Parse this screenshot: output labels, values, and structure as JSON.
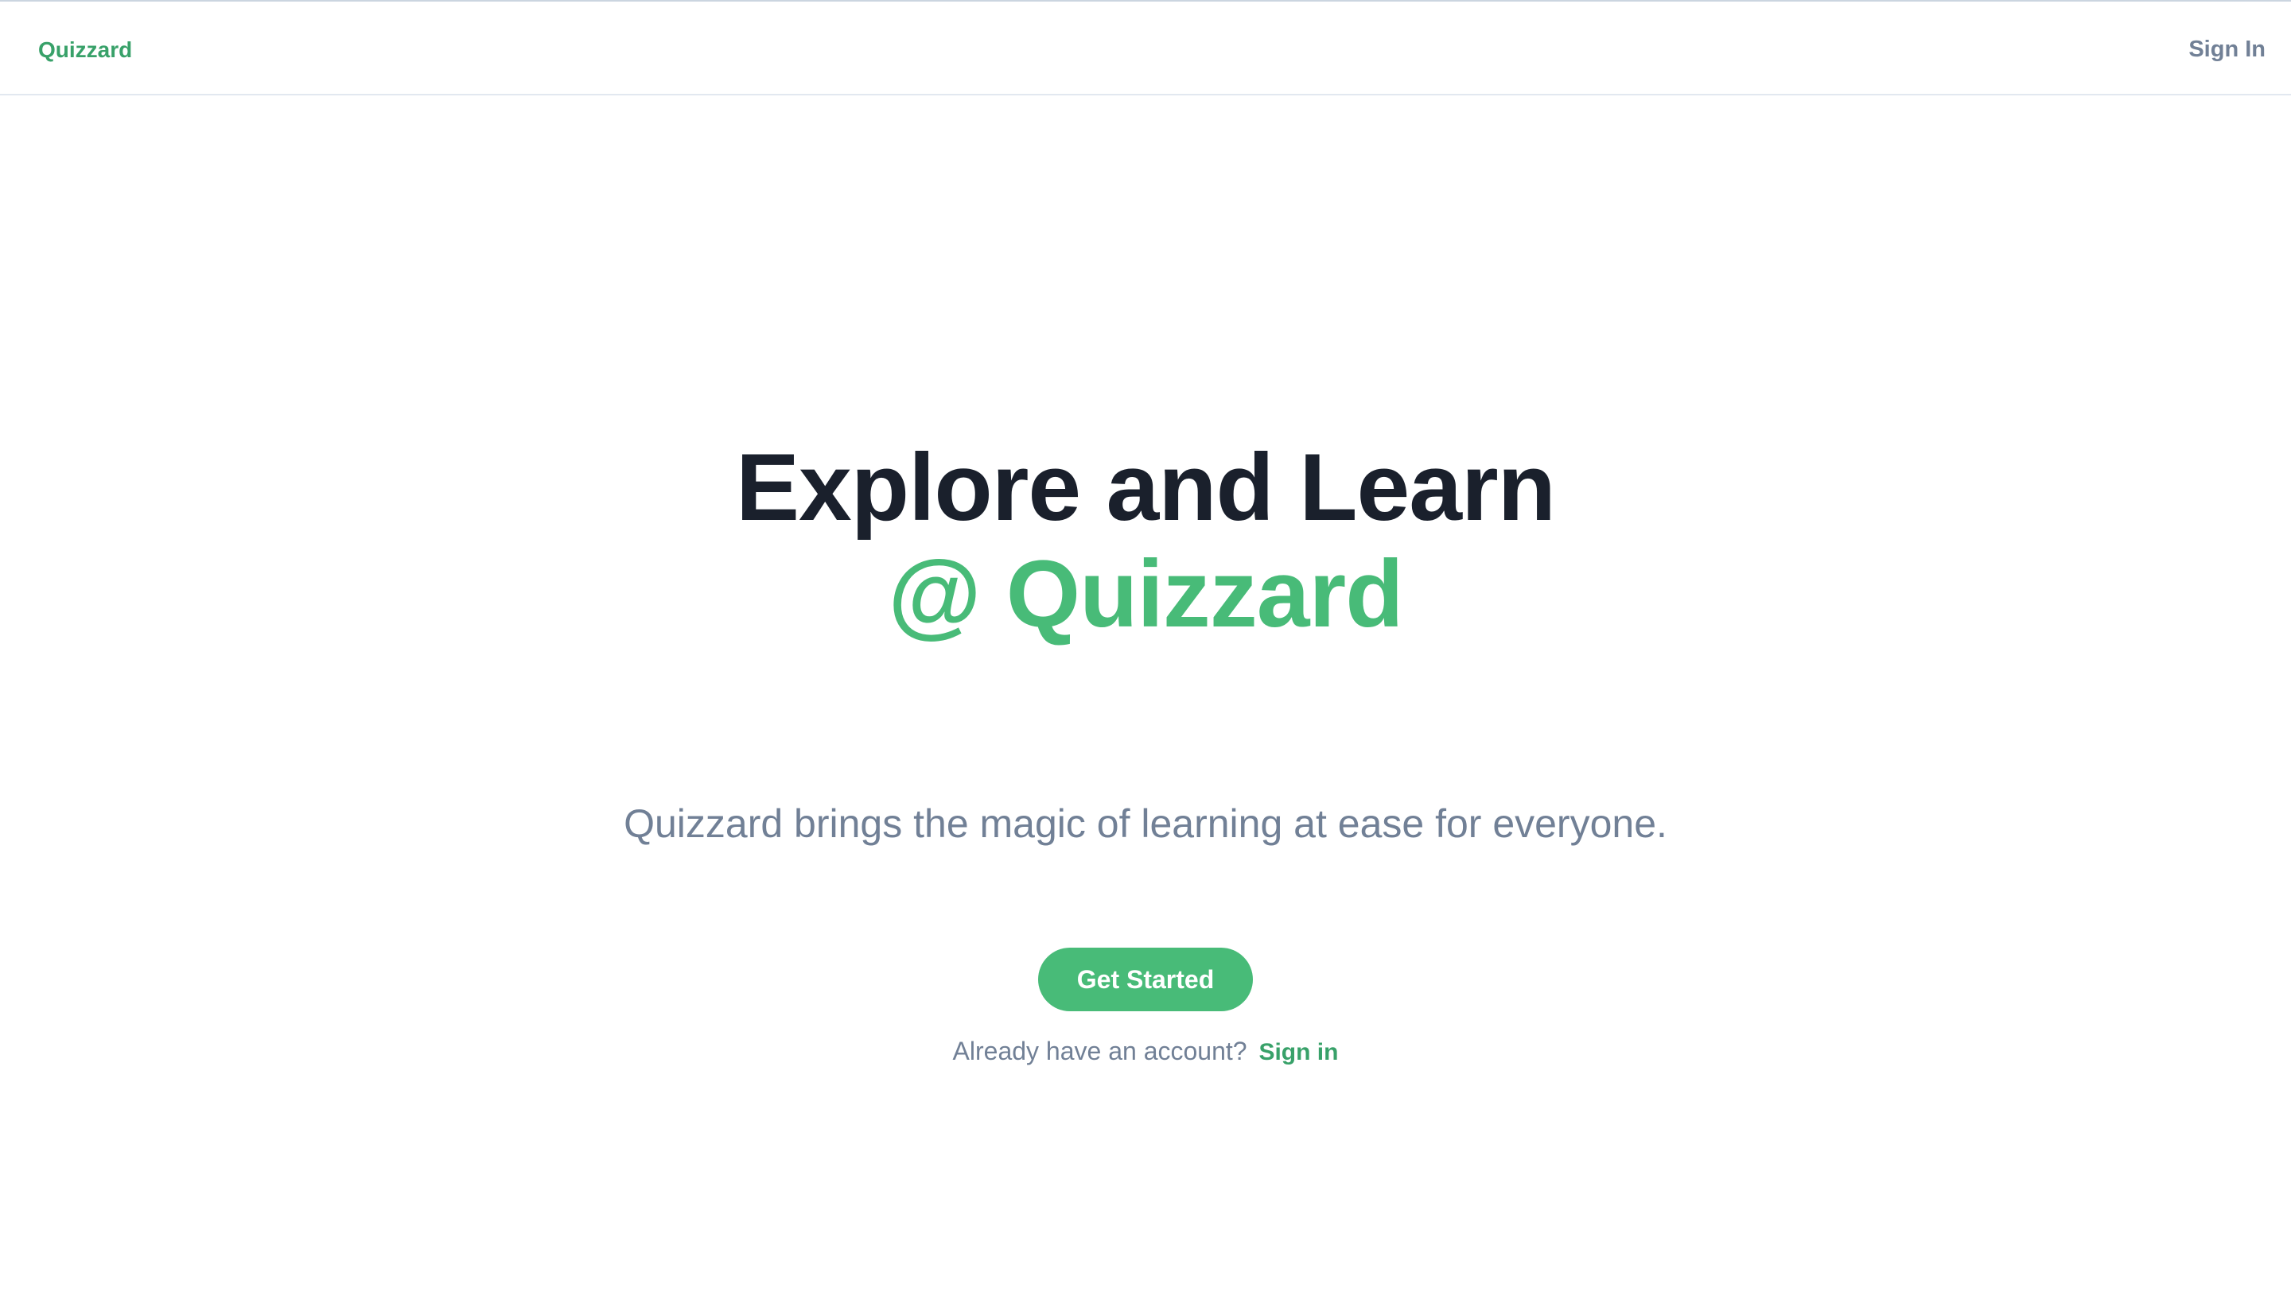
{
  "header": {
    "brand": "Quizzard",
    "sign_in": "Sign In"
  },
  "hero": {
    "headline_line1": "Explore and Learn",
    "headline_line2": "@ Quizzard",
    "subtitle": "Quizzard brings the magic of learning at ease for everyone.",
    "cta_label": "Get Started",
    "account_prompt": "Already have an account?",
    "account_link": "Sign in"
  },
  "colors": {
    "brand_green": "#48bb78",
    "link_green": "#38a169",
    "heading_dark": "#1a202c",
    "muted_text": "#718096"
  }
}
